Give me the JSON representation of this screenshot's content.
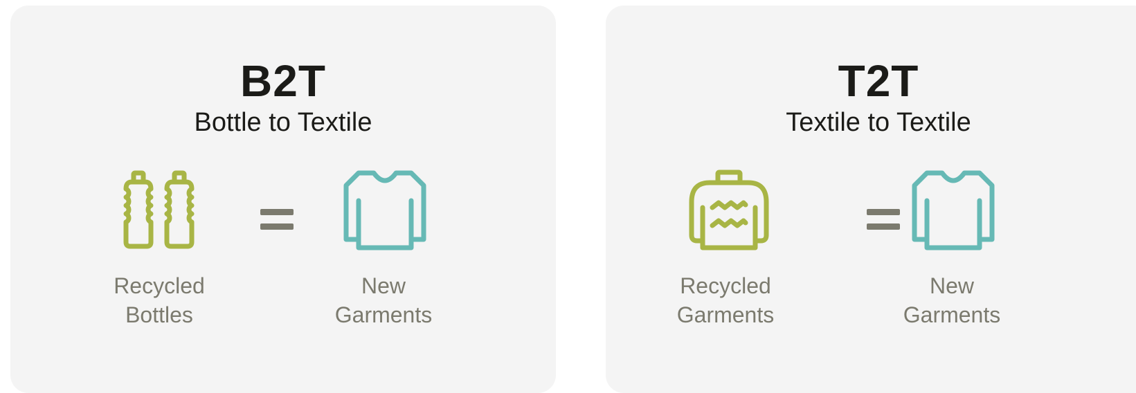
{
  "cards": [
    {
      "code": "B2T",
      "subtitle": "Bottle to Textile",
      "input": {
        "icon": "bottles-icon",
        "line1": "Recycled",
        "line2": "Bottles"
      },
      "output": {
        "icon": "shirt-icon",
        "line1": "New",
        "line2": "Garments"
      }
    },
    {
      "code": "T2T",
      "subtitle": "Textile to Textile",
      "input": {
        "icon": "sweater-icon",
        "line1": "Recycled",
        "line2": "Garments"
      },
      "output": {
        "icon": "shirt-icon",
        "line1": "New",
        "line2": "Garments"
      }
    }
  ],
  "colors": {
    "card_bg": "#f4f4f4",
    "title": "#1b1b18",
    "label": "#7b7a6e",
    "recycled_icon": "#a8b545",
    "new_icon": "#66b9b5",
    "equals": "#7b7a6e"
  }
}
